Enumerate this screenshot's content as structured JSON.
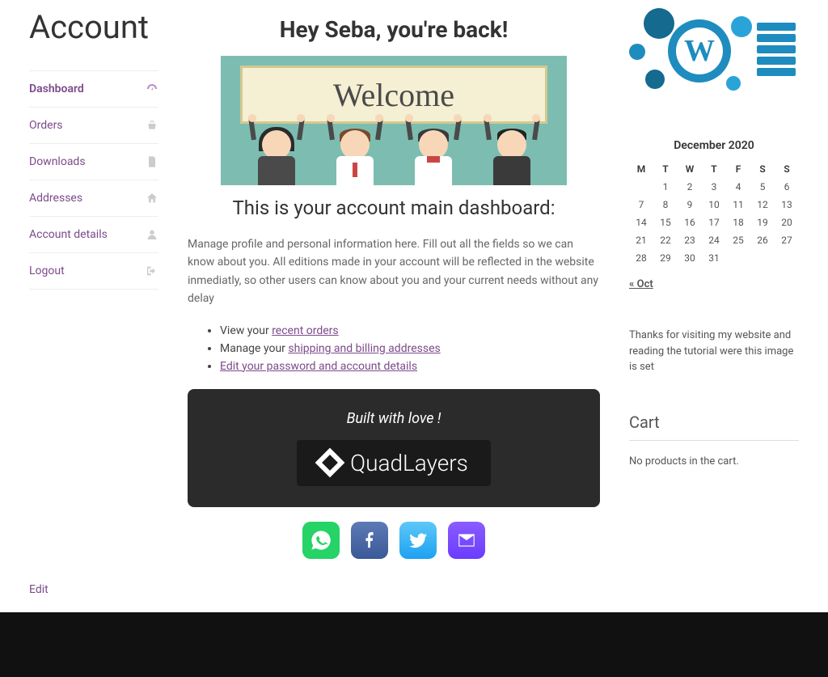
{
  "page_title": "Account",
  "nav": [
    {
      "label": "Dashboard",
      "icon": "dashboard-icon",
      "active": true
    },
    {
      "label": "Orders",
      "icon": "basket-icon",
      "active": false
    },
    {
      "label": "Downloads",
      "icon": "file-icon",
      "active": false
    },
    {
      "label": "Addresses",
      "icon": "home-icon",
      "active": false
    },
    {
      "label": "Account details",
      "icon": "user-icon",
      "active": false
    },
    {
      "label": "Logout",
      "icon": "signout-icon",
      "active": false
    }
  ],
  "welcome": {
    "heading": "Hey Seba, you're back!",
    "banner_text": "Welcome",
    "sub_heading": "This is your account main dashboard:",
    "description": "Manage profile and personal information here. Fill out all the fields so we can know about you. All editions made in your account will be reflected in the website inmediatly, so other users can know about you and your current needs without any delay",
    "actions": {
      "view_prefix": "View your ",
      "view_link": "recent orders",
      "manage_prefix": "Manage your ",
      "manage_link": "shipping and billing addresses",
      "edit_link": "Edit your password and account details"
    }
  },
  "built_box": {
    "text": "Built with love !",
    "brand": "QuadLayers"
  },
  "social": [
    "whatsapp",
    "facebook",
    "twitter",
    "email"
  ],
  "calendar": {
    "caption": "December 2020",
    "headers": [
      "M",
      "T",
      "W",
      "T",
      "F",
      "S",
      "S"
    ],
    "weeks": [
      [
        "",
        "1",
        "2",
        "3",
        "4",
        "5",
        "6"
      ],
      [
        "7",
        "8",
        "9",
        "10",
        "11",
        "12",
        "13"
      ],
      [
        "14",
        "15",
        "16",
        "17",
        "18",
        "19",
        "20"
      ],
      [
        "21",
        "22",
        "23",
        "24",
        "25",
        "26",
        "27"
      ],
      [
        "28",
        "29",
        "30",
        "31",
        "",
        "",
        ""
      ]
    ],
    "prev_link": "« Oct"
  },
  "visit_text": "Thanks for visiting my website and reading the tutorial were this image is set",
  "cart": {
    "heading": "Cart",
    "empty_text": "No products in the cart."
  },
  "edit_link": "Edit"
}
